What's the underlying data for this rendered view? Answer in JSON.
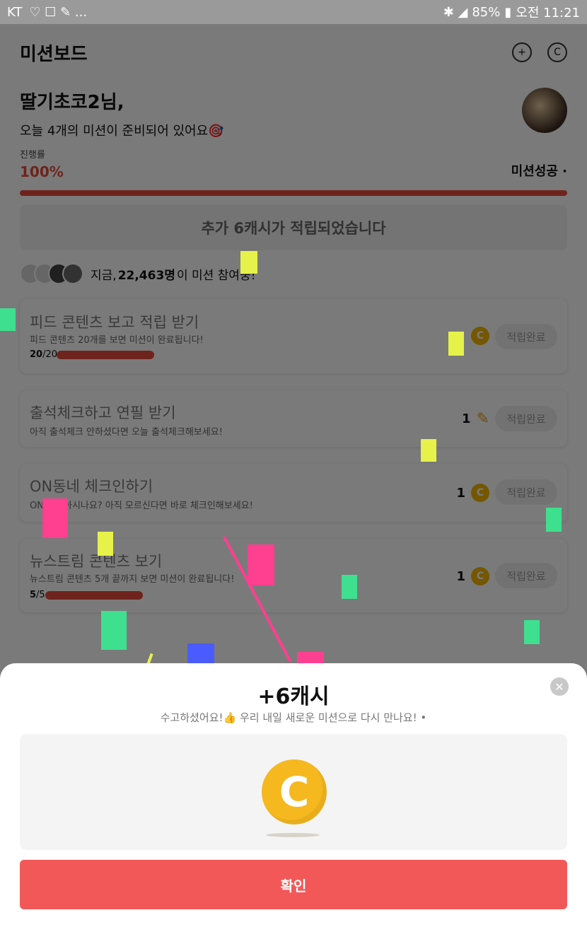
{
  "statusbar": {
    "carrier": "KT",
    "icons_left": "♡ ☐ ✎ ...",
    "battery": "85%",
    "time": "오전 11:21"
  },
  "header": {
    "title": "미션보드"
  },
  "greeting": {
    "name": "딸기초코2님,",
    "subtitle": "오늘 4개의 미션이 준비되어 있어요🎯"
  },
  "progress": {
    "label": "진행률",
    "percent": "100%",
    "percent_value": 100,
    "status": "미션성공 ·"
  },
  "banner": "추가 6캐시가 적립되었습니다",
  "participants": {
    "prefix": "지금,",
    "count": "22,463명",
    "suffix": "이 미션 참여중!"
  },
  "missions": [
    {
      "title": "피드 콘텐츠 보고 적립 받기",
      "desc": "피드 콘텐츠 20개를 보면 미션이 완료됩니다!",
      "progress_done": "20",
      "progress_total": "/20",
      "reward": "",
      "reward_icon": "coin-icon",
      "button": "적립완료"
    },
    {
      "title": "출석체크하고 연필 받기",
      "desc": "아직 출석체크 안하셨다면 오늘 출석체크해보세요!",
      "reward": "1",
      "reward_icon": "pencil-icon",
      "button": "적립완료"
    },
    {
      "title": "ON동네 체크인하기",
      "desc": "ON동네 아시나요? 아직 모르신다면 바로 체크인해보세요!",
      "reward": "1",
      "reward_icon": "coin-icon",
      "button": "적립완료"
    },
    {
      "title": "뉴스트림 콘텐츠 보기",
      "desc": "뉴스트림 콘텐츠 5개 끝까지 보면 미션이 완료됩니다!",
      "progress_done": "5",
      "progress_total": "/5",
      "reward": "1",
      "reward_icon": "coin-icon",
      "button": "적립완료"
    }
  ],
  "sheet": {
    "amount": "+6캐시",
    "message": "수고하셨어요!👍 우리 내일 새로운 미션으로 다시 만나요! •",
    "coin_glyph": "C",
    "confirm": "확인"
  },
  "colors": {
    "accent": "#e74c3c",
    "confirm": "#f25858",
    "coin": "#f6b81f"
  }
}
